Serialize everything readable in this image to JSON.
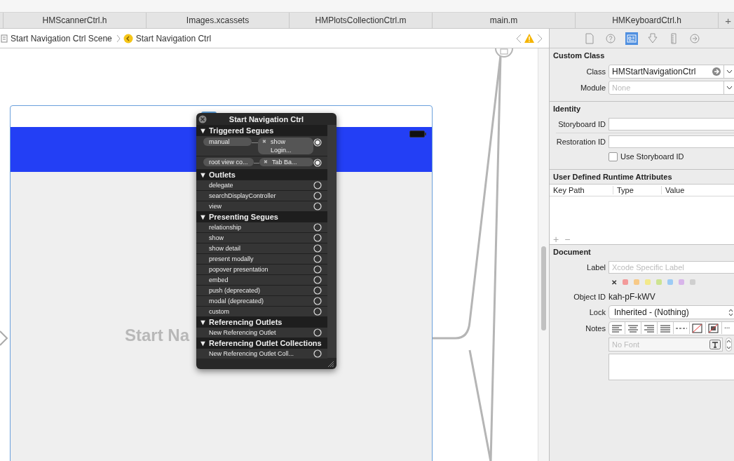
{
  "tabs": [
    {
      "label": "HMScannerCtrl.h",
      "selected": false
    },
    {
      "label": "Images.xcassets",
      "selected": false
    },
    {
      "label": "HMPlotsCollectionCtrl.m",
      "selected": false
    },
    {
      "label": "main.m",
      "selected": false
    },
    {
      "label": "HMKeyboardCtrl.h",
      "selected": false
    }
  ],
  "add_tab": "+",
  "breadcrumb": [
    "Start Navigation Ctrl Scene",
    "Start Navigation Ctrl"
  ],
  "canvas": {
    "scene_title": "Start Na"
  },
  "popup": {
    "title": "Start Navigation Ctrl",
    "sections": [
      {
        "title": "Triggered Segues",
        "disclosure": "▼",
        "rows": [
          {
            "kind": "segue",
            "name": "manual",
            "remove_mark": "✖",
            "target": [
              "show",
              "Login..."
            ],
            "connected": true
          },
          {
            "kind": "segue",
            "name": "root view co...",
            "remove_mark": "✖",
            "target": [
              "Tab Ba..."
            ],
            "connected": true
          }
        ]
      },
      {
        "title": "Outlets",
        "disclosure": "▼",
        "rows": [
          {
            "kind": "outlet",
            "name": "delegate",
            "connected": false
          },
          {
            "kind": "outlet",
            "name": "searchDisplayController",
            "connected": false
          },
          {
            "kind": "outlet",
            "name": "view",
            "connected": false
          }
        ]
      },
      {
        "title": "Presenting Segues",
        "disclosure": "▼",
        "rows": [
          {
            "kind": "outlet",
            "name": "relationship",
            "connected": false
          },
          {
            "kind": "outlet",
            "name": "show",
            "connected": false
          },
          {
            "kind": "outlet",
            "name": "show detail",
            "connected": false
          },
          {
            "kind": "outlet",
            "name": "present modally",
            "connected": false
          },
          {
            "kind": "outlet",
            "name": "popover presentation",
            "connected": false
          },
          {
            "kind": "outlet",
            "name": "embed",
            "connected": false
          },
          {
            "kind": "outlet",
            "name": "push (deprecated)",
            "connected": false
          },
          {
            "kind": "outlet",
            "name": "modal (deprecated)",
            "connected": false
          },
          {
            "kind": "outlet",
            "name": "custom",
            "connected": false
          }
        ]
      },
      {
        "title": "Referencing Outlets",
        "disclosure": "▼",
        "rows": [
          {
            "kind": "outlet",
            "name": "New Referencing Outlet",
            "connected": false
          }
        ]
      },
      {
        "title": "Referencing Outlet Collections",
        "disclosure": "▼",
        "rows": [
          {
            "kind": "outlet",
            "name": "New Referencing Outlet Coll...",
            "connected": false
          }
        ]
      }
    ]
  },
  "inspector": {
    "tabs": [
      {
        "kind": "file",
        "selected": false
      },
      {
        "kind": "help",
        "selected": false
      },
      {
        "kind": "identity",
        "selected": true
      },
      {
        "kind": "attributes",
        "selected": false
      },
      {
        "kind": "size",
        "selected": false
      },
      {
        "kind": "connections",
        "selected": false
      }
    ],
    "custom_class": {
      "title": "Custom Class",
      "class_label": "Class",
      "class_value": "HMStartNavigationCtrl",
      "module_label": "Module",
      "module_placeholder": "None"
    },
    "identity": {
      "title": "Identity",
      "storyboard_id_label": "Storyboard ID",
      "restoration_id_label": "Restoration ID",
      "use_storyboard_id": {
        "label": "Use Storyboard ID",
        "checked": false
      }
    },
    "runtime_attributes": {
      "title": "User Defined Runtime Attributes",
      "columns": [
        "Key Path",
        "Type",
        "Value"
      ],
      "add": "+",
      "remove": "−"
    },
    "document": {
      "title": "Document",
      "label_label": "Label",
      "label_placeholder": "Xcode Specific Label",
      "clear": "✕",
      "label_colors": [
        {
          "color": "#f39a9a"
        },
        {
          "color": "#f7c987"
        },
        {
          "color": "#f3e98a"
        },
        {
          "color": "#cde391"
        },
        {
          "color": "#9ccbf5"
        },
        {
          "color": "#d8b5ea"
        },
        {
          "color": "#cfcfcf"
        }
      ],
      "object_id_label": "Object ID",
      "object_id": "kah-pF-kWV",
      "lock_label": "Lock",
      "lock_value": "Inherited - (Nothing)",
      "notes_label": "Notes",
      "more": "...",
      "font_placeholder": "No Font"
    }
  }
}
